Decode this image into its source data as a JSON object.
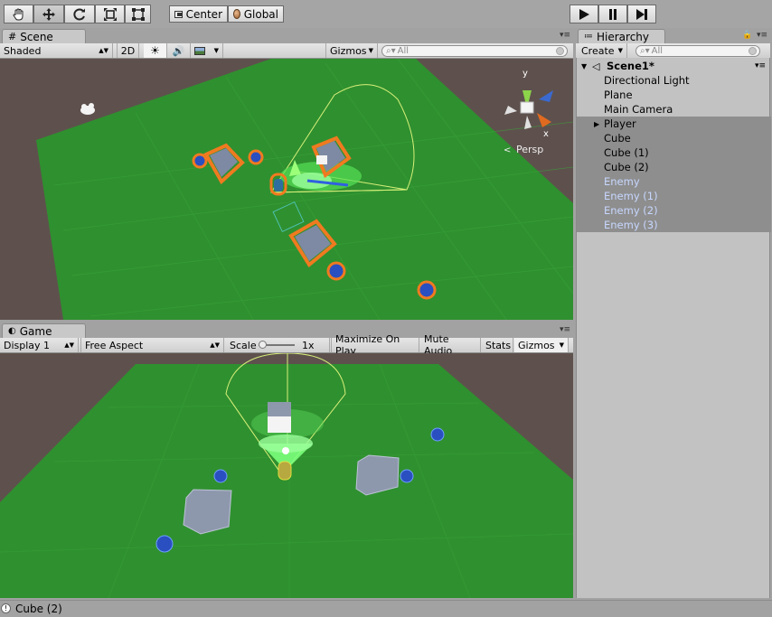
{
  "toolbar": {
    "tools": [
      "hand-tool",
      "move-tool",
      "rotate-tool",
      "scale-tool",
      "rect-tool"
    ],
    "pivot_label": "Center",
    "space_label": "Global"
  },
  "scene": {
    "tab_label": "Scene",
    "shading": "Shaded",
    "mode_2d": "2D",
    "gizmos": "Gizmos",
    "search_placeholder": "All",
    "persp_label": "Persp",
    "axis_y": "y",
    "axis_x": "x"
  },
  "game": {
    "tab_label": "Game",
    "display": "Display 1",
    "aspect": "Free Aspect",
    "scale_label": "Scale",
    "scale_value": "1x",
    "scale_fraction": 0.0,
    "maximize": "Maximize On Play",
    "mute": "Mute Audio",
    "stats": "Stats",
    "gizmos": "Gizmos"
  },
  "hierarchy": {
    "tab_label": "Hierarchy",
    "create_label": "Create",
    "search_placeholder": "All",
    "scene_name": "Scene1*",
    "items": [
      {
        "label": "Directional Light"
      },
      {
        "label": "Plane"
      },
      {
        "label": "Main Camera"
      },
      {
        "label": "Player"
      },
      {
        "label": "Cube"
      },
      {
        "label": "Cube (1)"
      },
      {
        "label": "Cube (2)"
      },
      {
        "label": "Enemy"
      },
      {
        "label": "Enemy (1)"
      },
      {
        "label": "Enemy (2)"
      },
      {
        "label": "Enemy (3)"
      }
    ]
  },
  "status": {
    "message": "Cube (2)"
  },
  "colors": {
    "ground": "#2e8f2e",
    "selection_outline": "#f07a20",
    "prefab_text": "#c7d7ff"
  }
}
